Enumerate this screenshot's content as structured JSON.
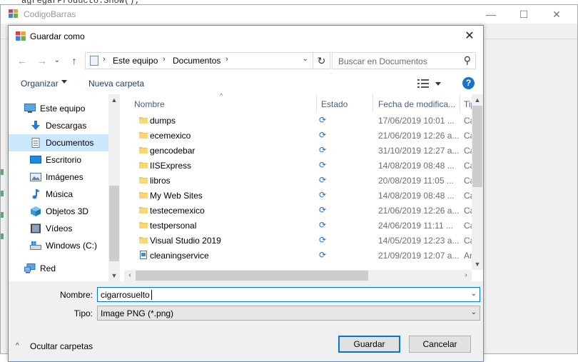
{
  "background_code": "agregarProducto.Show();",
  "parent_window": {
    "title": "CodigoBarras",
    "minimize_glyph": "—",
    "maximize_glyph": "☐",
    "close_glyph": "✕"
  },
  "dialog": {
    "title": "Guardar como",
    "close_glyph": "✕"
  },
  "navigation": {
    "back_glyph": "←",
    "forward_glyph": "→",
    "dropdown_glyph": "⌄",
    "up_glyph": "↑",
    "breadcrumb": [
      "Este equipo",
      "Documentos"
    ],
    "separator_glyph": "›",
    "address_drop_glyph": "⌄",
    "refresh_glyph": "↻",
    "search_placeholder": "Buscar en Documentos",
    "search_glyph": "⚲"
  },
  "toolbar": {
    "organize_label": "Organizar",
    "new_folder_label": "Nueva carpeta",
    "help_label": "?"
  },
  "nav_pane": {
    "items": [
      {
        "label": "Este equipo",
        "icon": "computer-icon",
        "root": true,
        "selected": false
      },
      {
        "label": "Descargas",
        "icon": "download-icon",
        "root": false,
        "selected": false
      },
      {
        "label": "Documentos",
        "icon": "document-icon",
        "root": false,
        "selected": true
      },
      {
        "label": "Escritorio",
        "icon": "desktop-icon",
        "root": false,
        "selected": false
      },
      {
        "label": "Imágenes",
        "icon": "pictures-icon",
        "root": false,
        "selected": false
      },
      {
        "label": "Música",
        "icon": "music-icon",
        "root": false,
        "selected": false
      },
      {
        "label": "Objetos 3D",
        "icon": "cube-icon",
        "root": false,
        "selected": false
      },
      {
        "label": "Vídeos",
        "icon": "video-icon",
        "root": false,
        "selected": false
      },
      {
        "label": "Windows (C:)",
        "icon": "drive-icon",
        "root": false,
        "selected": false
      },
      {
        "label": "Red",
        "icon": "network-icon",
        "root": true,
        "selected": false
      }
    ],
    "scroll_up_glyph": "▲",
    "scroll_down_glyph": "▼"
  },
  "file_list": {
    "columns": {
      "name": "Nombre",
      "status": "Estado",
      "date": "Fecha de modifica...",
      "type": "Tip"
    },
    "sort_glyph": "^",
    "sync_glyph": "⟳",
    "rows": [
      {
        "name": "dumps",
        "icon": "folder-icon",
        "date": "17/06/2019 10:01 ...",
        "type": "Ca"
      },
      {
        "name": "ecemexico",
        "icon": "folder-icon",
        "date": "21/06/2019 12:26 a...",
        "type": "Ca"
      },
      {
        "name": "gencodebar",
        "icon": "folder-icon",
        "date": "31/10/2019 12:27 a...",
        "type": "Ca"
      },
      {
        "name": "IISExpress",
        "icon": "folder-icon",
        "date": "14/08/2019 08:48 ...",
        "type": "Ca"
      },
      {
        "name": "libros",
        "icon": "folder-icon",
        "date": "20/08/2019 11:05 ...",
        "type": "Ca"
      },
      {
        "name": "My Web Sites",
        "icon": "folder-icon",
        "date": "14/08/2019 08:48 ...",
        "type": "Ca"
      },
      {
        "name": "testecemexico",
        "icon": "folder-icon",
        "date": "21/06/2019 12:26 a...",
        "type": "Ca"
      },
      {
        "name": "testpersonal",
        "icon": "folder-icon",
        "date": "24/06/2019 11:11 ...",
        "type": "Ca"
      },
      {
        "name": "Visual Studio 2019",
        "icon": "folder-icon",
        "date": "14/05/2019 12:23 a...",
        "type": "Ca"
      },
      {
        "name": "cleaningservice",
        "icon": "image-file-icon",
        "date": "21/09/2019 12:07 a...",
        "type": "Ar"
      }
    ],
    "scroll_up_glyph": "▲",
    "scroll_down_glyph": "▼",
    "scroll_left_glyph": "‹",
    "scroll_right_glyph": "›"
  },
  "form": {
    "name_label": "Nombre:",
    "name_value": "cigarrosuelto",
    "type_label": "Tipo:",
    "type_value": "Image PNG (*.png)",
    "drop_glyph": "⌄"
  },
  "footer": {
    "hide_folders_glyph": "^",
    "hide_folders_label": "Ocultar carpetas",
    "save_label": "Guardar",
    "cancel_label": "Cancelar"
  },
  "colors": {
    "selection": "#cce8ff",
    "accent": "#0078d7",
    "folder": "#f6c453",
    "sync": "#2a6cc1",
    "help": "#1a73c9"
  }
}
